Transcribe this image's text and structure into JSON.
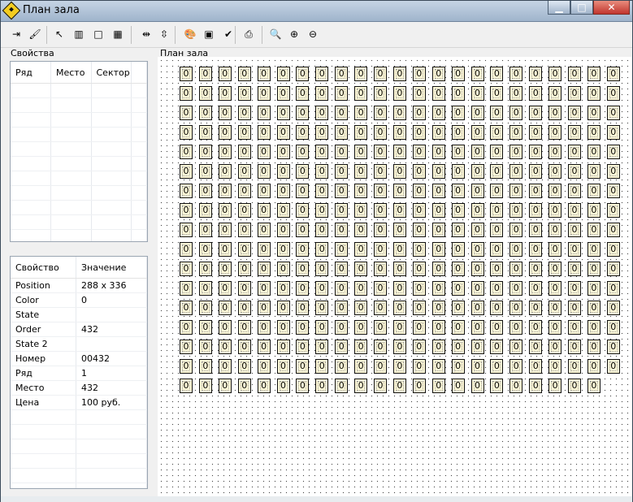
{
  "window": {
    "title": "План зала"
  },
  "toolbar": {
    "buttons": [
      {
        "name": "import-icon",
        "glyph": "⇥"
      },
      {
        "name": "brush-icon",
        "glyph": "🖌"
      },
      {
        "name": "pointer-icon",
        "glyph": "↖"
      },
      {
        "name": "row-select-icon",
        "glyph": "▥"
      },
      {
        "name": "rect-select-icon",
        "glyph": "□"
      },
      {
        "name": "grid-select-icon",
        "glyph": "▦"
      },
      {
        "name": "align-horizontal-icon",
        "glyph": "⇹"
      },
      {
        "name": "align-vertical-icon",
        "glyph": "⇳"
      },
      {
        "name": "palette-icon",
        "glyph": "🎨"
      },
      {
        "name": "image-icon",
        "glyph": "▣"
      },
      {
        "name": "apply-check-icon",
        "glyph": "✔"
      },
      {
        "name": "print-icon",
        "glyph": "⎙"
      },
      {
        "name": "zoom-fit-icon",
        "glyph": "🔍"
      },
      {
        "name": "zoom-in-icon",
        "glyph": "⊕"
      },
      {
        "name": "zoom-out-icon",
        "glyph": "⊖"
      }
    ]
  },
  "left": {
    "group_label": "Свойства",
    "seats_table": {
      "columns": [
        "Ряд",
        "Место",
        "Сектор"
      ],
      "rows": []
    },
    "props_table": {
      "columns": [
        "Свойство",
        "Значение"
      ],
      "rows": [
        [
          "Position",
          "288 x 336"
        ],
        [
          "Color",
          "0"
        ],
        [
          "State",
          ""
        ],
        [
          "Order",
          "432"
        ],
        [
          "State 2",
          ""
        ],
        [
          "Номер",
          "00432"
        ],
        [
          "Ряд",
          "1"
        ],
        [
          "Место",
          "432"
        ],
        [
          "Цена",
          "100 руб."
        ]
      ]
    }
  },
  "plan": {
    "label": "План зала",
    "seat_label": "0",
    "rows": 17,
    "cols": 23,
    "last_row_cols": 22
  }
}
